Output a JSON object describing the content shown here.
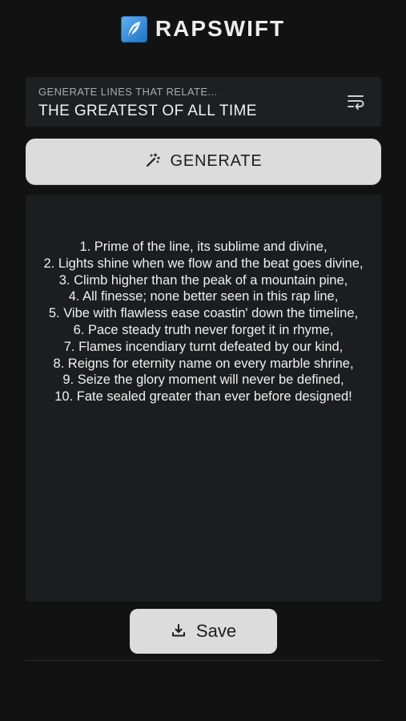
{
  "app": {
    "title": "RAPSWIFT",
    "logo_icon": "feather-icon"
  },
  "topic_field": {
    "label": "GENERATE LINES THAT RELATE...",
    "value": "THE GREATEST OF ALL TIME",
    "trailing_icon": "text-wrap-icon"
  },
  "generate_button": {
    "label": "GENERATE",
    "icon": "magic-wand-icon"
  },
  "output": {
    "lines": [
      "1. Prime of the line, its sublime and divine,",
      "2. Lights shine when we flow and the beat goes divine,",
      "3. Climb higher than the peak of a mountain pine,",
      "4. All finesse; none better seen in this rap line,",
      "5. Vibe with flawless ease coastin' down the timeline,",
      "6. Pace steady truth never forget it in rhyme,",
      "7. Flames incendiary turnt defeated by our kind,",
      "8. Reigns for eternity name on every marble shrine,",
      "9. Seize the glory moment will never be defined,",
      "10. Fate sealed greater than ever before designed!"
    ]
  },
  "save_button": {
    "label": "Save",
    "icon": "download-icon"
  },
  "colors": {
    "background": "#121212",
    "surface": "#1e1f22",
    "button": "#dcdcdc",
    "logo_accent": "#3a8ee0"
  }
}
